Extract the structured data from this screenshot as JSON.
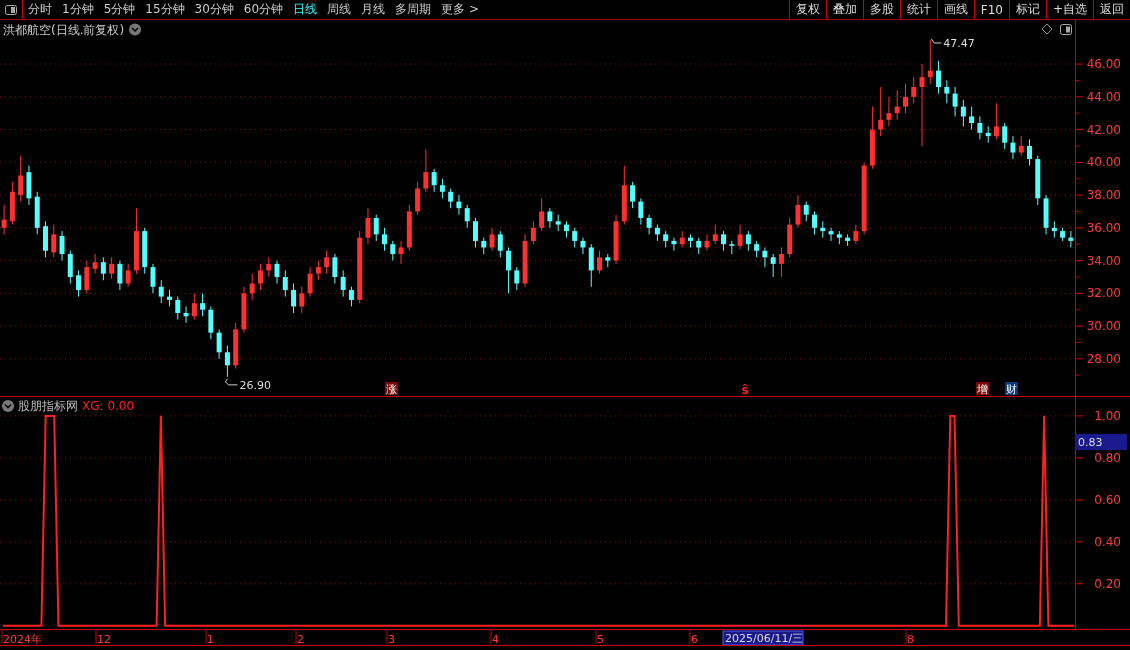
{
  "toolbar": {
    "periods": [
      {
        "label": "分时",
        "selected": false
      },
      {
        "label": "1分钟",
        "selected": false
      },
      {
        "label": "5分钟",
        "selected": false
      },
      {
        "label": "15分钟",
        "selected": false
      },
      {
        "label": "30分钟",
        "selected": false
      },
      {
        "label": "60分钟",
        "selected": false
      },
      {
        "label": "日线",
        "selected": true
      },
      {
        "label": "周线",
        "selected": false
      },
      {
        "label": "月线",
        "selected": false
      },
      {
        "label": "多周期",
        "selected": false
      },
      {
        "label": "更多 >",
        "selected": false
      }
    ],
    "buttons": [
      "复权",
      "叠加",
      "多股",
      "统计",
      "画线",
      "F10",
      "标记",
      "+自选",
      "返回"
    ]
  },
  "main_chart": {
    "title": "洪都航空(日线.前复权)",
    "chart_data": {
      "type": "candlestick",
      "grid": true,
      "ylim": [
        25.67,
        48.69
      ],
      "yticks": [
        {
          "value": 46,
          "label": "46.00"
        },
        {
          "value": 44,
          "label": "44.00"
        },
        {
          "value": 42,
          "label": "42.00"
        },
        {
          "value": 40,
          "label": "40.00"
        },
        {
          "value": 38,
          "label": "38.00"
        },
        {
          "value": 36,
          "label": "36.00"
        },
        {
          "value": 34,
          "label": "34.00"
        },
        {
          "value": 32,
          "label": "32.00"
        },
        {
          "value": 30,
          "label": "30.00"
        },
        {
          "value": 28,
          "label": "28.00"
        }
      ],
      "categories": [
        null,
        null,
        null,
        null,
        null,
        null,
        null,
        null,
        null,
        null,
        null,
        null,
        null,
        null,
        null,
        null,
        null,
        null,
        null,
        null,
        null,
        null,
        null,
        null,
        null,
        null,
        null,
        null,
        null,
        null,
        null,
        null,
        null,
        null,
        null,
        null,
        null,
        null,
        null,
        null,
        null,
        null,
        null,
        null,
        null,
        null,
        null,
        null,
        null,
        null,
        null,
        null,
        null,
        null,
        null,
        null,
        null,
        null,
        null,
        null,
        null,
        null,
        null,
        null,
        null,
        null,
        null,
        null,
        null,
        null,
        null,
        null,
        null,
        null,
        null,
        null,
        null,
        null,
        null,
        null,
        null,
        null,
        null,
        null,
        null,
        null,
        null,
        null,
        null,
        null,
        null,
        null,
        null,
        null,
        null,
        null,
        null,
        null,
        null,
        null,
        null,
        null,
        null,
        null,
        null,
        null,
        null,
        null,
        null,
        null,
        null,
        null,
        null,
        null,
        null,
        null,
        null,
        null,
        null,
        null,
        null,
        null,
        null,
        null,
        null,
        null,
        null,
        null,
        null,
        null
      ],
      "ohlc": [
        [
          36.0,
          37.4,
          35.6,
          36.5
        ],
        [
          36.4,
          38.8,
          36.2,
          38.2
        ],
        [
          38.0,
          40.4,
          37.6,
          39.2
        ],
        [
          39.4,
          39.8,
          37.4,
          37.8
        ],
        [
          37.9,
          38.2,
          35.6,
          36.0
        ],
        [
          36.1,
          36.4,
          34.2,
          34.6
        ],
        [
          34.5,
          36.2,
          34.2,
          35.6
        ],
        [
          35.5,
          35.8,
          34.0,
          34.4
        ],
        [
          34.4,
          34.6,
          32.6,
          33.0
        ],
        [
          33.1,
          33.4,
          31.8,
          32.2
        ],
        [
          32.2,
          34.0,
          32.0,
          33.6
        ],
        [
          33.5,
          34.4,
          33.2,
          33.9
        ],
        [
          33.9,
          34.2,
          32.8,
          33.2
        ],
        [
          33.2,
          34.2,
          32.9,
          33.8
        ],
        [
          33.8,
          34.0,
          32.2,
          32.6
        ],
        [
          32.6,
          33.8,
          32.4,
          33.4
        ],
        [
          33.4,
          37.2,
          33.2,
          35.8
        ],
        [
          35.8,
          36.0,
          33.2,
          33.6
        ],
        [
          33.6,
          33.8,
          32.0,
          32.4
        ],
        [
          32.4,
          32.8,
          31.4,
          31.8
        ],
        [
          31.8,
          32.2,
          31.2,
          31.6
        ],
        [
          31.6,
          31.8,
          30.4,
          30.8
        ],
        [
          30.8,
          31.2,
          30.2,
          30.6
        ],
        [
          30.6,
          32.0,
          30.4,
          31.4
        ],
        [
          31.4,
          32.0,
          30.6,
          31.0
        ],
        [
          31.0,
          31.2,
          29.2,
          29.6
        ],
        [
          29.6,
          29.8,
          28.0,
          28.4
        ],
        [
          28.4,
          28.8,
          26.9,
          27.6
        ],
        [
          27.6,
          30.2,
          27.4,
          29.8
        ],
        [
          29.8,
          32.4,
          29.6,
          32.0
        ],
        [
          32.0,
          33.2,
          31.6,
          32.6
        ],
        [
          32.6,
          33.8,
          32.2,
          33.4
        ],
        [
          33.4,
          34.2,
          33.0,
          33.8
        ],
        [
          33.8,
          34.0,
          32.6,
          33.0
        ],
        [
          33.0,
          33.4,
          31.8,
          32.2
        ],
        [
          32.2,
          32.6,
          30.8,
          31.2
        ],
        [
          31.2,
          32.4,
          30.8,
          32.0
        ],
        [
          32.0,
          33.6,
          31.8,
          33.2
        ],
        [
          33.2,
          34.0,
          32.8,
          33.6
        ],
        [
          33.6,
          34.6,
          33.2,
          34.2
        ],
        [
          34.2,
          34.4,
          32.6,
          33.0
        ],
        [
          33.0,
          33.4,
          31.8,
          32.2
        ],
        [
          32.2,
          32.4,
          31.2,
          31.6
        ],
        [
          31.6,
          35.8,
          31.4,
          35.4
        ],
        [
          35.4,
          37.2,
          35.0,
          36.6
        ],
        [
          36.6,
          36.8,
          35.2,
          35.6
        ],
        [
          35.6,
          36.0,
          34.6,
          35.0
        ],
        [
          35.0,
          35.2,
          34.0,
          34.4
        ],
        [
          34.4,
          35.2,
          33.8,
          34.8
        ],
        [
          34.8,
          37.4,
          34.6,
          37.0
        ],
        [
          37.0,
          38.8,
          36.8,
          38.4
        ],
        [
          38.4,
          40.8,
          38.2,
          39.4
        ],
        [
          39.4,
          39.6,
          38.2,
          38.6
        ],
        [
          38.6,
          39.0,
          37.8,
          38.2
        ],
        [
          38.2,
          38.4,
          37.2,
          37.6
        ],
        [
          37.6,
          38.0,
          36.8,
          37.2
        ],
        [
          37.2,
          37.4,
          36.0,
          36.4
        ],
        [
          36.4,
          36.6,
          34.8,
          35.2
        ],
        [
          35.2,
          35.4,
          34.4,
          34.8
        ],
        [
          34.8,
          36.0,
          34.6,
          35.6
        ],
        [
          35.6,
          35.8,
          34.2,
          34.6
        ],
        [
          34.6,
          34.8,
          32.0,
          33.4
        ],
        [
          33.4,
          33.6,
          32.2,
          32.6
        ],
        [
          32.6,
          35.6,
          32.4,
          35.2
        ],
        [
          35.2,
          36.4,
          35.0,
          36.0
        ],
        [
          36.0,
          37.8,
          35.8,
          37.0
        ],
        [
          37.0,
          37.2,
          36.0,
          36.4
        ],
        [
          36.4,
          36.8,
          35.8,
          36.2
        ],
        [
          36.2,
          36.4,
          35.4,
          35.8
        ],
        [
          35.8,
          36.0,
          34.8,
          35.2
        ],
        [
          35.2,
          35.4,
          34.4,
          34.8
        ],
        [
          34.8,
          35.0,
          32.4,
          33.4
        ],
        [
          33.4,
          34.6,
          33.2,
          34.2
        ],
        [
          34.2,
          34.4,
          33.6,
          34.0
        ],
        [
          34.0,
          36.8,
          33.8,
          36.4
        ],
        [
          36.4,
          39.8,
          36.2,
          38.6
        ],
        [
          38.6,
          38.8,
          37.2,
          37.6
        ],
        [
          37.6,
          37.8,
          36.2,
          36.6
        ],
        [
          36.6,
          36.8,
          35.6,
          36.0
        ],
        [
          36.0,
          36.2,
          35.2,
          35.6
        ],
        [
          35.6,
          35.8,
          34.8,
          35.2
        ],
        [
          35.2,
          35.4,
          34.6,
          35.0
        ],
        [
          35.0,
          35.8,
          34.8,
          35.4
        ],
        [
          35.4,
          35.6,
          34.8,
          35.2
        ],
        [
          35.2,
          35.4,
          34.4,
          34.8
        ],
        [
          34.8,
          35.6,
          34.6,
          35.2
        ],
        [
          35.2,
          36.2,
          35.0,
          35.6
        ],
        [
          35.6,
          35.8,
          34.6,
          35.0
        ],
        [
          35.0,
          35.2,
          34.4,
          34.9
        ],
        [
          34.9,
          36.2,
          34.7,
          35.6
        ],
        [
          35.6,
          35.8,
          34.6,
          35.0
        ],
        [
          35.0,
          35.2,
          34.2,
          34.6
        ],
        [
          34.6,
          34.8,
          33.6,
          34.2
        ],
        [
          34.2,
          34.4,
          33.0,
          33.8
        ],
        [
          33.8,
          34.8,
          33.0,
          34.4
        ],
        [
          34.4,
          36.6,
          34.2,
          36.2
        ],
        [
          36.2,
          38.0,
          36.0,
          37.4
        ],
        [
          37.4,
          37.6,
          36.4,
          36.8
        ],
        [
          36.8,
          37.0,
          35.6,
          36.0
        ],
        [
          36.0,
          36.4,
          35.4,
          35.8
        ],
        [
          35.8,
          36.0,
          35.2,
          35.6
        ],
        [
          35.6,
          35.8,
          35.0,
          35.4
        ],
        [
          35.4,
          35.6,
          34.9,
          35.2
        ],
        [
          35.2,
          36.2,
          35.0,
          35.8
        ],
        [
          35.8,
          40.0,
          35.6,
          39.8
        ],
        [
          39.8,
          43.4,
          39.6,
          42.0
        ],
        [
          42.0,
          44.6,
          41.6,
          42.6
        ],
        [
          42.6,
          44.0,
          42.2,
          43.0
        ],
        [
          43.0,
          44.4,
          42.6,
          43.4
        ],
        [
          43.4,
          44.8,
          43.0,
          44.0
        ],
        [
          44.0,
          45.2,
          43.6,
          44.6
        ],
        [
          44.6,
          46.0,
          41.0,
          45.2
        ],
        [
          45.2,
          47.47,
          44.8,
          45.6
        ],
        [
          45.6,
          46.2,
          44.2,
          44.6
        ],
        [
          44.6,
          45.0,
          43.6,
          44.2
        ],
        [
          44.2,
          44.6,
          42.8,
          43.4
        ],
        [
          43.4,
          43.8,
          42.2,
          42.8
        ],
        [
          42.8,
          43.4,
          42.0,
          42.4
        ],
        [
          42.4,
          42.8,
          41.4,
          41.8
        ],
        [
          41.8,
          42.2,
          41.2,
          41.6
        ],
        [
          41.6,
          43.6,
          41.4,
          42.2
        ],
        [
          42.2,
          42.4,
          40.8,
          41.2
        ],
        [
          41.2,
          41.6,
          40.2,
          40.6
        ],
        [
          40.6,
          41.6,
          40.4,
          41.0
        ],
        [
          41.0,
          41.4,
          39.8,
          40.2
        ],
        [
          40.2,
          40.4,
          37.4,
          37.8
        ],
        [
          37.8,
          38.0,
          35.6,
          36.0
        ],
        [
          36.0,
          36.4,
          35.4,
          35.8
        ],
        [
          35.8,
          36.0,
          35.2,
          35.4
        ],
        [
          35.4,
          35.8,
          34.8,
          35.2
        ]
      ]
    },
    "high_label": "47.47",
    "low_label": "26.90",
    "markers": [
      {
        "text": "涨",
        "kind": "badge",
        "color": "#7a0a0a"
      },
      {
        "text": "ŝ",
        "kind": "plain",
        "color": "#ff2020"
      },
      {
        "text": "增",
        "kind": "badge",
        "color": "#7a0a0a"
      },
      {
        "text": "财",
        "kind": "badge",
        "color": "#0a3a7a"
      }
    ]
  },
  "indicator": {
    "name": "股朋指标网",
    "value": "XG: 0.00",
    "cursor_value": "0.83",
    "chart_data": {
      "type": "line",
      "grid": true,
      "categories": [
        null,
        null,
        null,
        null,
        null,
        null,
        null,
        null,
        null,
        null,
        null,
        null,
        null,
        null,
        null,
        null,
        null,
        null,
        null,
        null,
        null,
        null,
        null,
        null,
        null,
        null,
        null,
        null,
        null,
        null,
        null,
        null,
        null,
        null,
        null,
        null,
        null,
        null,
        null,
        null,
        null,
        null,
        null,
        null,
        null,
        null,
        null,
        null,
        null,
        null,
        null,
        null,
        null,
        null,
        null,
        null,
        null,
        null,
        null,
        null,
        null,
        null,
        null,
        null,
        null,
        null,
        null,
        null,
        null,
        null,
        null,
        null,
        null,
        null,
        null,
        null,
        null,
        null,
        null,
        null,
        null,
        null,
        null,
        null,
        null,
        null,
        null,
        null,
        null,
        null,
        null,
        null,
        null,
        null,
        null,
        null,
        null,
        null,
        null,
        null,
        null,
        null,
        null,
        null,
        null,
        null,
        null,
        null,
        null,
        null,
        null,
        null,
        null,
        null,
        null,
        null,
        null,
        null,
        null,
        null,
        null,
        null,
        null,
        null,
        null,
        null,
        null,
        null,
        null,
        null,
        null,
        null,
        null,
        null,
        null,
        null,
        null,
        null,
        null,
        null,
        null,
        null,
        null,
        null,
        null,
        null,
        null,
        null,
        null,
        null,
        null,
        null,
        null,
        null,
        null,
        null,
        null,
        null,
        null,
        null,
        null,
        null,
        null,
        null,
        null,
        null,
        null,
        null,
        null,
        null,
        null,
        null,
        null,
        null,
        null,
        null,
        null,
        null,
        null,
        null,
        null,
        null,
        null,
        null,
        null,
        null,
        null,
        null,
        null,
        null,
        null,
        null,
        null,
        null,
        null,
        null,
        null,
        null,
        null,
        null,
        null,
        null,
        null,
        null,
        null,
        null,
        null,
        null,
        null,
        null,
        null,
        null,
        null,
        null,
        null,
        null,
        null,
        null,
        null,
        null,
        null,
        null,
        null,
        null,
        null,
        null,
        null,
        null,
        null,
        null,
        null,
        null,
        null,
        null,
        null,
        null,
        null,
        null,
        null,
        null,
        null,
        null,
        null,
        null,
        null,
        null,
        null,
        null,
        null,
        null,
        null,
        null
      ],
      "ylim": [
        -0.02,
        1.09
      ],
      "yticks": [
        {
          "value": 1,
          "label": "1.00"
        },
        {
          "value": 0.8,
          "label": "0.80"
        },
        {
          "value": 0.6,
          "label": "0.60"
        },
        {
          "value": 0.4,
          "label": "0.40"
        },
        {
          "value": 0.2,
          "label": "0.20"
        }
      ],
      "series": [
        {
          "color": "#ff2020",
          "values": [
            0,
            0,
            0,
            0,
            0,
            0,
            0,
            0,
            0,
            0,
            1,
            1,
            1,
            0,
            0,
            0,
            0,
            0,
            0,
            0,
            0,
            0,
            0,
            0,
            0,
            0,
            0,
            0,
            0,
            0,
            0,
            0,
            0,
            0,
            0,
            0,
            0,
            1,
            0,
            0,
            0,
            0,
            0,
            0,
            0,
            0,
            0,
            0,
            0,
            0,
            0,
            0,
            0,
            0,
            0,
            0,
            0,
            0,
            0,
            0,
            0,
            0,
            0,
            0,
            0,
            0,
            0,
            0,
            0,
            0,
            0,
            0,
            0,
            0,
            0,
            0,
            0,
            0,
            0,
            0,
            0,
            0,
            0,
            0,
            0,
            0,
            0,
            0,
            0,
            0,
            0,
            0,
            0,
            0,
            0,
            0,
            0,
            0,
            0,
            0,
            0,
            0,
            0,
            0,
            0,
            0,
            0,
            0,
            0,
            0,
            0,
            0,
            0,
            0,
            0,
            0,
            0,
            0,
            0,
            0,
            0,
            0,
            0,
            0,
            0,
            0,
            0,
            0,
            0,
            0,
            0,
            0,
            0,
            0,
            0,
            0,
            0,
            0,
            0,
            0,
            0,
            0,
            0,
            0,
            0,
            0,
            0,
            0,
            0,
            0,
            0,
            0,
            0,
            0,
            0,
            0,
            0,
            0,
            0,
            0,
            0,
            0,
            0,
            0,
            0,
            0,
            0,
            0,
            0,
            0,
            0,
            0,
            0,
            0,
            0,
            0,
            0,
            0,
            0,
            0,
            0,
            0,
            0,
            0,
            0,
            0,
            0,
            0,
            0,
            0,
            0,
            0,
            0,
            0,
            0,
            0,
            0,
            0,
            0,
            0,
            0,
            0,
            0,
            0,
            0,
            0,
            0,
            0,
            0,
            0,
            0,
            0,
            0,
            0,
            0,
            0,
            0,
            0,
            0,
            0,
            0,
            0,
            1,
            1,
            0,
            0,
            0,
            0,
            0,
            0,
            0,
            0,
            0,
            0,
            0,
            0,
            0,
            0,
            0,
            0,
            0,
            0,
            0,
            0,
            1,
            0,
            0,
            0,
            0,
            0,
            0,
            0
          ]
        }
      ]
    }
  },
  "date_axis": [
    {
      "label": "2024年",
      "kind": "tick"
    },
    {
      "label": "12",
      "kind": "tick"
    },
    {
      "label": "1",
      "kind": "tick"
    },
    {
      "label": "2",
      "kind": "tick"
    },
    {
      "label": "3",
      "kind": "tick"
    },
    {
      "label": "4",
      "kind": "tick"
    },
    {
      "label": "5",
      "kind": "tick"
    },
    {
      "label": "6",
      "kind": "tick"
    },
    {
      "label": "2025/06/11/三",
      "kind": "cursor"
    },
    {
      "label": "8",
      "kind": "tick"
    }
  ]
}
